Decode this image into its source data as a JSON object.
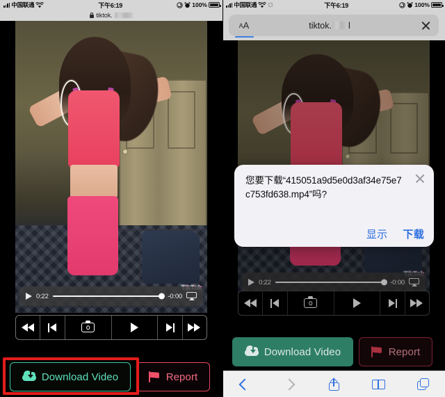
{
  "status_bar": {
    "carrier": "中国联通",
    "time": "下午6:19",
    "battery_percent": "100%",
    "signal_icon": "signal-bars-icon",
    "wifi_icon": "wifi-icon",
    "rotation_lock_icon": "rotation-lock-icon",
    "alarm_icon": "alarm-clock-icon",
    "battery_icon": "battery-full-icon"
  },
  "left_panel": {
    "mini_urlbar": {
      "lock_icon": "lock-icon",
      "domain": "tiktok."
    },
    "player": {
      "play_icon": "play-icon",
      "elapsed": "0:22",
      "remaining": "-0:00",
      "airplay_icon": "airplay-icon",
      "progress_percent": 99
    },
    "transport": {
      "rewind_icon": "rewind-icon",
      "previous_icon": "previous-track-icon",
      "camera_icon": "camera-icon",
      "play_icon": "play-icon",
      "next_icon": "next-track-icon",
      "fastforward_icon": "fast-forward-icon"
    },
    "actions": {
      "download_label": "Download Video",
      "download_icon": "cloud-download-icon",
      "report_label": "Report",
      "report_icon": "flag-icon"
    },
    "annotation": {
      "shape": "rectangle-highlight",
      "color": "#e41c1c"
    }
  },
  "right_panel": {
    "urlbar": {
      "text_size_label_small": "A",
      "text_size_label_big": "A",
      "text_size_icon": "text-size-icon",
      "domain": "tiktok.",
      "close_icon": "close-icon"
    },
    "player": {
      "play_icon": "play-icon",
      "elapsed": "0:22",
      "remaining": "-0:00",
      "airplay_icon": "airplay-icon",
      "progress_percent": 99
    },
    "transport": {
      "rewind_icon": "rewind-icon",
      "previous_icon": "previous-track-icon",
      "camera_icon": "camera-icon",
      "play_icon": "play-icon",
      "next_icon": "next-track-icon",
      "fastforward_icon": "fast-forward-icon"
    },
    "dialog": {
      "message": "您要下载“415051a9d5e0d3af34e75e7c753fd638.mp4”吗?",
      "close_icon": "close-icon",
      "secondary_label": "显示",
      "primary_label": "下载",
      "accent_color": "#2f70e0"
    },
    "actions": {
      "download_label": "Download Video",
      "download_icon": "cloud-download-icon",
      "report_label": "Report",
      "report_icon": "flag-icon"
    },
    "toolbar": {
      "back_icon": "back-chevron-icon",
      "forward_icon": "forward-chevron-icon",
      "share_icon": "share-icon",
      "bookmarks_icon": "bookmarks-icon",
      "tabs_icon": "tabs-icon"
    }
  },
  "video": {
    "watermark": "TikTok"
  },
  "colors": {
    "download_fill": "#2e7e65",
    "download_outline_text": "#5fe0ba",
    "report_outline_text": "#f36b82",
    "annotation_red": "#e41c1c",
    "ios_blue": "#2f70e0"
  }
}
